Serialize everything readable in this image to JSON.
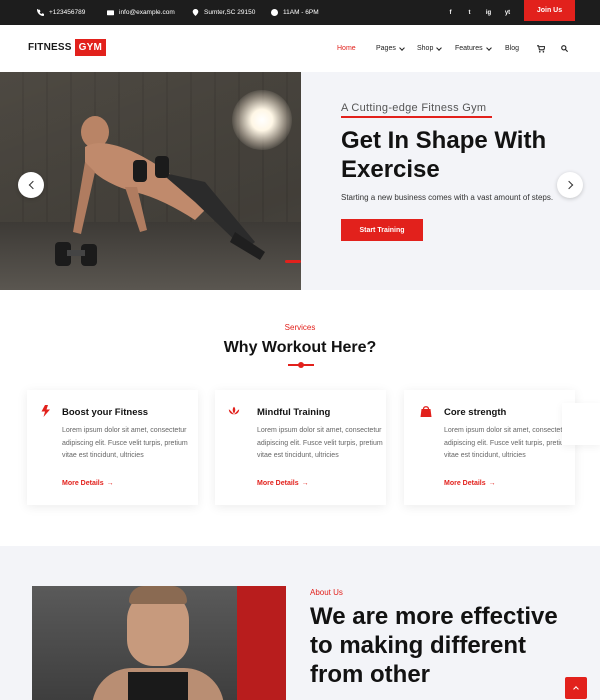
{
  "topbar": {
    "phone": "+123456789",
    "email": "info@example.com",
    "address": "Sumter,SC 29150",
    "hours": "11AM - 6PM",
    "social": [
      "f",
      "t",
      "ig",
      "yt"
    ],
    "join_label": "Join Us"
  },
  "header": {
    "logo_word": "FITNESS",
    "logo_badge": "GYM",
    "nav": [
      {
        "label": "Home",
        "active": true,
        "dropdown": false
      },
      {
        "label": "Pages",
        "active": false,
        "dropdown": true
      },
      {
        "label": "Shop",
        "active": false,
        "dropdown": true
      },
      {
        "label": "Features",
        "active": false,
        "dropdown": true
      },
      {
        "label": "Blog",
        "active": false,
        "dropdown": false
      }
    ],
    "cart_icon": "cart-icon",
    "search_icon": "search-icon"
  },
  "hero": {
    "subtitle": "A Cutting-edge Fitness Gym",
    "title": "Get In Shape With Exercise",
    "description": "Starting a new business comes with a vast amount of steps.",
    "button_label": "Start Training",
    "slides_total": 2,
    "slide_active": 1
  },
  "services": {
    "label": "Services",
    "title": "Why Workout Here?",
    "cards": [
      {
        "icon": "lightning-icon",
        "title": "Boost your Fitness",
        "text": "Lorem ipsum dolor sit amet, consectetur adipiscing elit. Fusce velit turpis, pretium vitae est tincidunt, ultricies",
        "link": "More Details"
      },
      {
        "icon": "lotus-icon",
        "title": "Mindful Training",
        "text": "Lorem ipsum dolor sit amet, consectetur adipiscing elit. Fusce velit turpis, pretium vitae est tincidunt, ultricies",
        "link": "More Details"
      },
      {
        "icon": "bag-icon",
        "title": "Core strength",
        "text": "Lorem ipsum dolor sit amet, consectetur adipiscing elit. Fusce velit turpis, pretium vitae est tincidunt, ultricies",
        "link": "More Details"
      }
    ]
  },
  "about": {
    "label": "About Us",
    "title": "We are more effective to making different from other"
  },
  "colors": {
    "accent": "#e2211c",
    "topbar_bg": "#1d1d1d",
    "section_bg": "#f3f4f8"
  }
}
